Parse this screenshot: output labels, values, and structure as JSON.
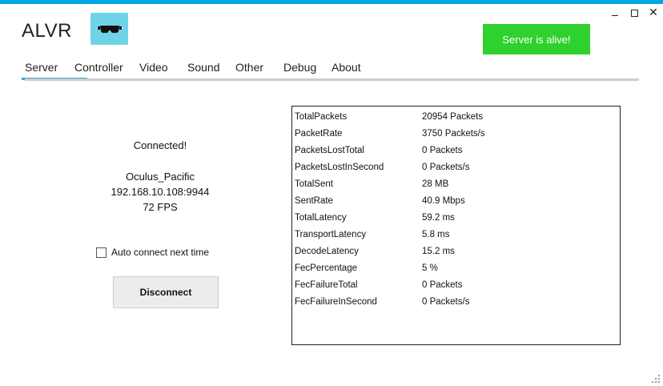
{
  "window": {
    "title": "ALVR",
    "accent_color": "#00a8e0",
    "controls": {
      "minimize_icon": "minimize-icon",
      "maximize_icon": "maximize-icon",
      "close_glyph": "✕"
    }
  },
  "header": {
    "logo_icon": "vr-headset-icon",
    "server_status": "Server is alive!",
    "server_status_color": "#2ed12e"
  },
  "tabs": [
    {
      "label": "Server",
      "active": true
    },
    {
      "label": "Controller",
      "active": false
    },
    {
      "label": "Video",
      "active": false
    },
    {
      "label": "Sound",
      "active": false
    },
    {
      "label": "Other",
      "active": false
    },
    {
      "label": "Debug",
      "active": false
    },
    {
      "label": "About",
      "active": false
    }
  ],
  "connection": {
    "status": "Connected!",
    "device_name": "Oculus_Pacific",
    "address": "192.168.10.108:9944",
    "fps": "72 FPS",
    "auto_connect_label": "Auto connect next time",
    "auto_connect_checked": false,
    "disconnect_label": "Disconnect"
  },
  "stats": [
    {
      "name": "TotalPackets",
      "value": "20954 Packets"
    },
    {
      "name": "PacketRate",
      "value": "3750 Packets/s"
    },
    {
      "name": "PacketsLostTotal",
      "value": "0 Packets"
    },
    {
      "name": "PacketsLostInSecond",
      "value": "0 Packets/s"
    },
    {
      "name": "TotalSent",
      "value": "28 MB"
    },
    {
      "name": "SentRate",
      "value": "40.9 Mbps"
    },
    {
      "name": "TotalLatency",
      "value": "59.2 ms"
    },
    {
      "name": "TransportLatency",
      "value": "5.8 ms"
    },
    {
      "name": "DecodeLatency",
      "value": "15.2 ms"
    },
    {
      "name": "FecPercentage",
      "value": "5 %"
    },
    {
      "name": "FecFailureTotal",
      "value": "0 Packets"
    },
    {
      "name": "FecFailureInSecond",
      "value": "0 Packets/s"
    }
  ]
}
